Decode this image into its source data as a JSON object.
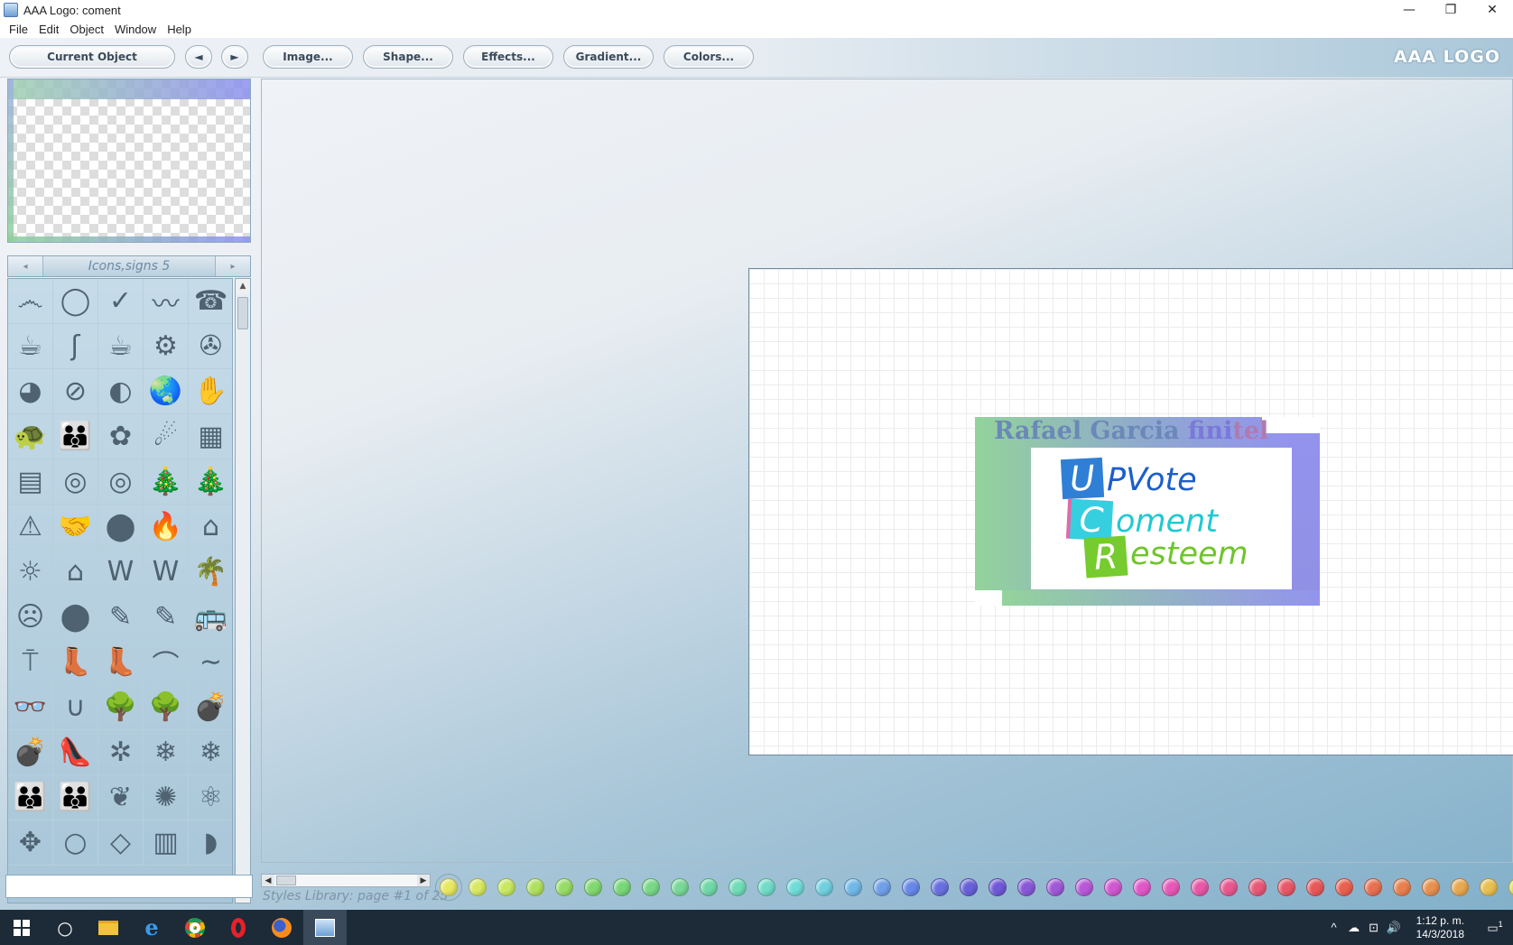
{
  "window": {
    "title": "AAA Logo: coment",
    "minimize": "—",
    "maximize": "❐",
    "close": "✕"
  },
  "menu": [
    "File",
    "Edit",
    "Object",
    "Window",
    "Help"
  ],
  "toolbar": {
    "current_object": "Current Object",
    "prev": "◄",
    "next": "►",
    "image": "Image...",
    "shape": "Shape...",
    "effects": "Effects...",
    "gradient": "Gradient...",
    "colors": "Colors...",
    "brand": "AAA LOGO"
  },
  "library": {
    "title": "Icons,signs 5",
    "prev": "◂",
    "next": "▸",
    "icons": [
      "෴",
      "◯",
      "✓",
      "〰",
      "☎",
      "☕",
      "ʃ",
      "☕",
      "⚙",
      "✇",
      "◕",
      "⊘",
      "◐",
      "🌏",
      "✋",
      "🐢",
      "👪",
      "✿",
      "☄",
      "▦",
      "▤",
      "◎",
      "◎",
      "🎄",
      "🎄",
      "⚠",
      "🤝",
      "⬤",
      "🔥",
      "⌂",
      "☼",
      "⌂",
      "W",
      "W",
      "🌴",
      "☹",
      "⬤",
      "✎",
      "✎",
      "🚌",
      "⍑",
      "👢",
      "👢",
      "⌒",
      "∼",
      "👓",
      "∪",
      "🌳",
      "🌳",
      "💣",
      "💣",
      "👠",
      "✲",
      "❄",
      "❄",
      "👪",
      "👪",
      "❦",
      "✺",
      "⚛",
      "✥",
      "○",
      "◇",
      "▥",
      "◗"
    ],
    "status": "Styles Library: page #1 of 25"
  },
  "scroll": {
    "up": "▲",
    "down": "▼",
    "left": "◀",
    "right": "▶"
  },
  "logo": {
    "name_a": "Rafael Garcia",
    "name_b": " fini",
    "name_c": "tel",
    "sq1": "U",
    "sq2": "C",
    "sq3": "R",
    "line1": "PVote",
    "line2": "oment",
    "line3": "esteem"
  },
  "swatch_colors": [
    "#e8e860",
    "#d8e860",
    "#c8e860",
    "#b0e060",
    "#98dc68",
    "#80d870",
    "#78d878",
    "#78d888",
    "#78d898",
    "#70d8a8",
    "#70dcb8",
    "#70dcc8",
    "#70dcd8",
    "#70d0e0",
    "#70b8e8",
    "#70a0e8",
    "#6888e8",
    "#6870e0",
    "#6860d8",
    "#7058d8",
    "#8858d8",
    "#a058d8",
    "#b858d8",
    "#d058d0",
    "#e058c8",
    "#e858b8",
    "#e858a8",
    "#e85890",
    "#e85878",
    "#e85868",
    "#e85858",
    "#e86050",
    "#e87050",
    "#e88050",
    "#e89050",
    "#e8a850",
    "#e8c050",
    "#e8d850"
  ],
  "taskbar": {
    "search": "○",
    "tray": [
      "^",
      "☁",
      "⊡",
      "🔊"
    ],
    "time": "1:12 p. m.",
    "date": "14/3/2018",
    "notifications": "1"
  }
}
